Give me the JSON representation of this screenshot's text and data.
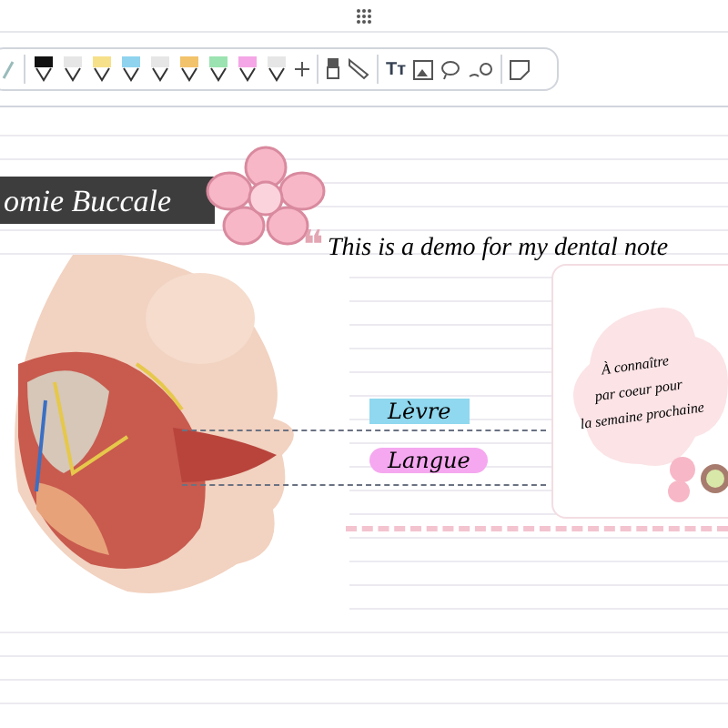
{
  "toolbar": {
    "pens": [
      {
        "color": "#111111"
      },
      {
        "color": "#e6e6e6"
      },
      {
        "color": "#f7e08a"
      },
      {
        "color": "#8fd3ef"
      },
      {
        "color": "#e6e6e6"
      },
      {
        "color": "#f2c36b"
      },
      {
        "color": "#9be3b0"
      },
      {
        "color": "#f4a6e6"
      },
      {
        "color": "#e6e6e6"
      }
    ],
    "text_tool": "Tт"
  },
  "page": {
    "banner": "omie Buccale",
    "quote_mark": "❝",
    "quote": "This is a demo for my dental note",
    "labels": [
      {
        "text": "Lèvre",
        "color": "#8fd8ef",
        "kind": "rect"
      },
      {
        "text": "Langue",
        "color": "#f5a8ef",
        "kind": "pill"
      }
    ],
    "card": {
      "lines": [
        "À connaître",
        "par coeur pour",
        "la semaine prochaine"
      ]
    }
  }
}
